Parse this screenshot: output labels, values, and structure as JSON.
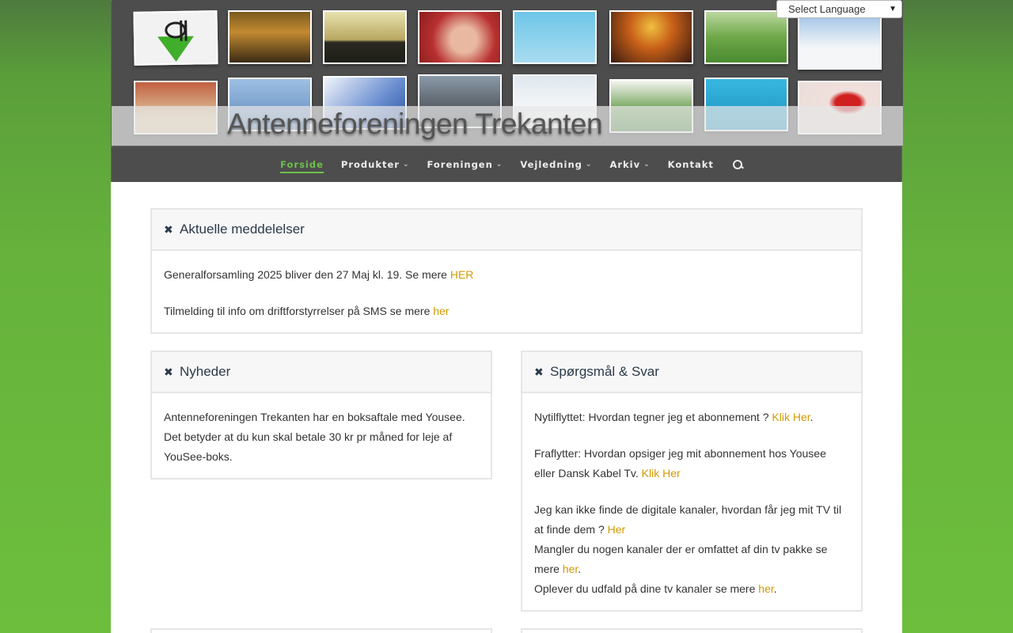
{
  "language_select": {
    "value": "Select Language"
  },
  "header": {
    "site_title": "Antenneforeningen Trekanten"
  },
  "nav": {
    "items": [
      {
        "label": "Forside",
        "has_dropdown": false,
        "active": true
      },
      {
        "label": "Produkter",
        "has_dropdown": true
      },
      {
        "label": "Foreningen",
        "has_dropdown": true
      },
      {
        "label": "Vejledning",
        "has_dropdown": true
      },
      {
        "label": "Arkiv",
        "has_dropdown": true
      },
      {
        "label": "Kontakt",
        "has_dropdown": false
      }
    ],
    "search_icon": "search-icon"
  },
  "panels": {
    "aktuelle": {
      "title": "Aktuelle meddelelser",
      "line1_text": "Generalforsamling 2025 bliver den 27 Maj kl. 19. Se mere ",
      "line1_link": "HER",
      "line2_text": "Tilmelding til info om driftforstyrrelser på SMS se mere ",
      "line2_link": "her"
    },
    "nyheder": {
      "title": "Nyheder",
      "text": "Antenneforeningen Trekanten har en boksaftale med Yousee. Det betyder at du kun skal betale 30 kr pr måned for leje af YouSee-boks."
    },
    "faq": {
      "title": "Spørgsmål & Svar",
      "q1_text": "Nytilflyttet: Hvordan tegner jeg et abonnement ? ",
      "q1_link": "Klik Her",
      "q1_end": ".",
      "q2_text": "Fraflytter: Hvordan opsiger jeg mit abonnement hos Yousee eller Dansk Kabel Tv. ",
      "q2_link": "Klik Her",
      "q3_text": "Jeg kan ikke finde de digitale kanaler, hvordan får jeg mit TV til at finde dem ? ",
      "q3_link": "Her",
      "q4_text": "Mangler du nogen kanaler der er omfattet af din tv pakke se mere ",
      "q4_link": "her",
      "q4_end": ".",
      "q5_text": "Oplever du udfald på dine tv kanaler se mere ",
      "q5_link": "her",
      "q5_end": "."
    }
  },
  "colors": {
    "accent": "#6cc04a",
    "link": "#d29a00",
    "header_bg": "#4d4d4d"
  }
}
